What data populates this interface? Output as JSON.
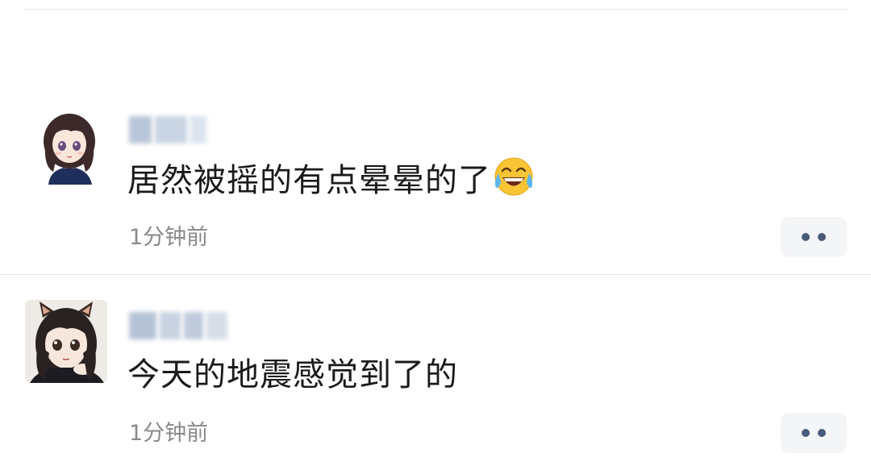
{
  "comments": [
    {
      "username": "",
      "text": "居然被摇的有点晕晕的了",
      "emoji": "laughing-tears-emoji",
      "timestamp": "1分钟前"
    },
    {
      "username": "",
      "text": "今天的地震感觉到了的",
      "timestamp": "1分钟前"
    }
  ],
  "colors": {
    "text": "#1a1a1a",
    "timestamp": "#8a8a8a",
    "more_button_bg": "#f4f5f7",
    "more_dot": "#4a5b7a",
    "divider": "#e8e8e8"
  }
}
